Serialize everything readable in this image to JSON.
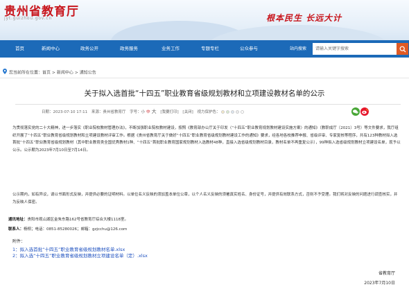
{
  "header": {
    "site_title": "贵州省教育厅",
    "site_domain": "jyt.guizhou.gov.cn",
    "slogan": "根本民生 长远大计"
  },
  "nav": {
    "items": [
      "首页",
      "新闻中心",
      "政务公开",
      "政务服务",
      "业务工作",
      "专题专栏",
      "公众参与"
    ],
    "search_label": "站内搜索",
    "search_placeholder": "请输入关键字搜索"
  },
  "breadcrumb": {
    "prefix": "您当前所在位置：",
    "path": "首页 > 新闻中心 > 通知公告"
  },
  "article": {
    "title": "关于拟入选首批“十四五”职业教育省级规划教材和立项建设教材名单的公示",
    "meta": {
      "date": "日期：2023-07-10 17:11",
      "source": "来源：贵州省教育厅",
      "font_label": "字号：",
      "font_small": "小",
      "font_medium": "中",
      "font_large": "大",
      "print": "[我要打印]",
      "close": "[关闭]",
      "protection_label": "视力保护色："
    },
    "body_p1": "为贯彻落实党的二十大精神，进一步落实《职业院校教材管理办法》，不断加强职业院校教材建设，按照《教育部办公厅关于印发〈“十四五”职业教育规划教材建设实施方案〉的通知》（教职成厅〔2021〕3号）等文件要求，我厅组织开展了“十四五”职业教育省级规划教材和立项建设教材评审工作。根据《贵州省教育厅关于做好“十四五”职业教育省级规划教材建设工作的通知》要求，经各地各校推荐申报、省级评审、专家复核等程序，共有123种教材拟入选首批“十四五”职业教育省级规划教材（其中职业教育类全国优秀教材1种、“十四五”首批职业教育国家规划教材入选教材48种，直接入选省级规划教材目录，教材名单不再重复公示），99种拟入选省级规划教材立项建设名单，现予以公示。公示期为2023年7月10日至7月14日。",
    "body_p2": "公示期内，如有异议，请以书面形式反映，并提供必要的证明材料。以单位名义反映的须加盖本单位公章，以个人名义反映的须署真实姓名、身份证号，并提供有效联系方式，否则不予受理。我们将对反映的问题进行调查核实，并为反映人保密。",
    "address_label": "通讯地址：",
    "address": "贵阳市观山湖区金朱东路162号省教育厅综合大楼1118室。",
    "contact_label": "联系人：",
    "contact": "杨栩；电话：0851-85280026；邮箱：gzjcchu@126.com"
  },
  "attachments": {
    "label": "附件：",
    "items": [
      "1：拟入选首批“十四五”职业教育省级规划教材名单.xlsx",
      "2：拟入选“十四五”职业教育省级规划教材立项建设名单（定）.xlsx"
    ]
  },
  "signature": {
    "org": "省教育厅",
    "date": "2023年7月10日"
  },
  "colors": {
    "brand_red": "#c8161d",
    "nav_blue": "#1c6ab8",
    "search_orange": "#e05a24",
    "link_blue": "#1c4fbf"
  }
}
